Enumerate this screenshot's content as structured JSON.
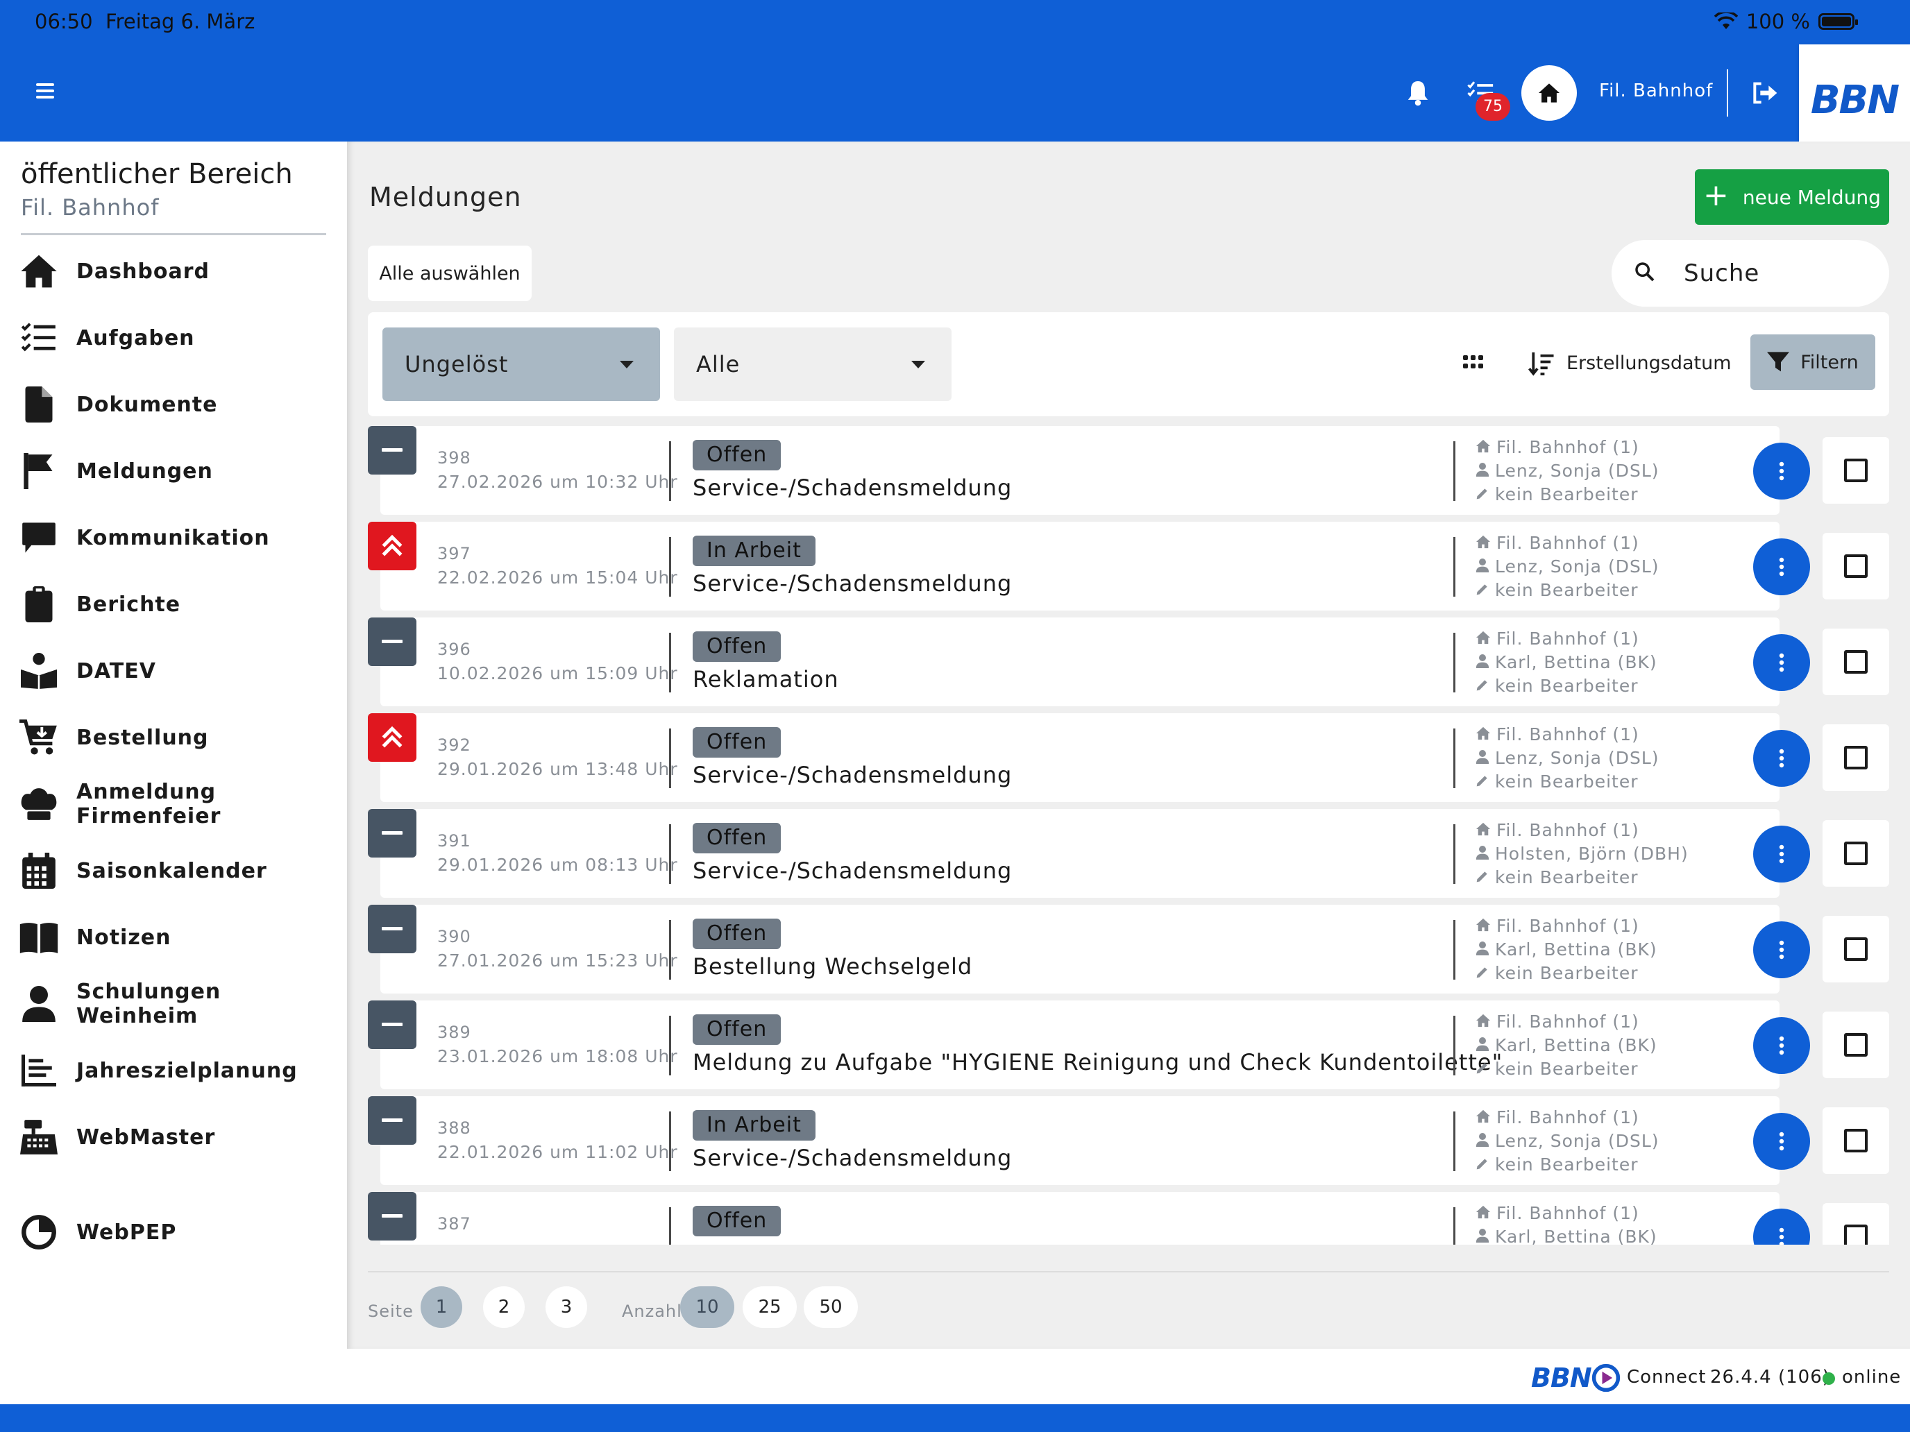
{
  "status_bar": {
    "time": "06:50",
    "date": "Freitag 6. März",
    "battery": "100 %"
  },
  "header": {
    "task_badge": "75",
    "branch": "Fil. Bahnhof",
    "logo": "BBN"
  },
  "sidebar": {
    "title": "öffentlicher Bereich",
    "subtitle": "Fil. Bahnhof",
    "items": [
      {
        "label": "Dashboard",
        "icon": "home-icon"
      },
      {
        "label": "Aufgaben",
        "icon": "checklist-icon"
      },
      {
        "label": "Dokumente",
        "icon": "document-icon"
      },
      {
        "label": "Meldungen",
        "icon": "flag-icon"
      },
      {
        "label": "Kommunikation",
        "icon": "chat-icon"
      },
      {
        "label": "Berichte",
        "icon": "clipboard-icon"
      },
      {
        "label": "DATEV",
        "icon": "reader-icon"
      },
      {
        "label": "Bestellung",
        "icon": "cart-icon"
      },
      {
        "label": "Anmeldung Firmenfeier",
        "icon": "chef-hat-icon"
      },
      {
        "label": "Saisonkalender",
        "icon": "calendar-icon"
      },
      {
        "label": "Notizen",
        "icon": "book-icon"
      },
      {
        "label": "Schulungen Weinheim",
        "icon": "person-icon"
      },
      {
        "label": "Jahreszielplanung",
        "icon": "bar-list-icon"
      },
      {
        "label": "WebMaster",
        "icon": "cash-register-icon"
      },
      {
        "label": "WebPEP",
        "icon": "pie-chart-icon"
      }
    ]
  },
  "main": {
    "title": "Meldungen",
    "new_button": "neue Meldung",
    "select_all": "Alle auswählen",
    "search_placeholder": "Suche",
    "filter_status": "Ungelöst",
    "filter_type": "Alle",
    "sort_label": "Erstellungsdatum",
    "filter_button": "Filtern"
  },
  "reports": [
    {
      "id": "398",
      "date": "27.02.2026 um 10:32 Uhr",
      "status": "Offen",
      "title": "Service-/Schadensmeldung",
      "branch": "Fil. Bahnhof (1)",
      "person": "Lenz, Sonja (DSL)",
      "editor": "kein Bearbeiter",
      "priority": "normal"
    },
    {
      "id": "397",
      "date": "22.02.2026 um 15:04 Uhr",
      "status": "In Arbeit",
      "title": "Service-/Schadensmeldung",
      "branch": "Fil. Bahnhof (1)",
      "person": "Lenz, Sonja (DSL)",
      "editor": "kein Bearbeiter",
      "priority": "high"
    },
    {
      "id": "396",
      "date": "10.02.2026 um 15:09 Uhr",
      "status": "Offen",
      "title": "Reklamation",
      "branch": "Fil. Bahnhof (1)",
      "person": "Karl, Bettina (BK)",
      "editor": "kein Bearbeiter",
      "priority": "normal"
    },
    {
      "id": "392",
      "date": "29.01.2026 um 13:48 Uhr",
      "status": "Offen",
      "title": "Service-/Schadensmeldung",
      "branch": "Fil. Bahnhof (1)",
      "person": "Lenz, Sonja (DSL)",
      "editor": "kein Bearbeiter",
      "priority": "high"
    },
    {
      "id": "391",
      "date": "29.01.2026 um 08:13 Uhr",
      "status": "Offen",
      "title": "Service-/Schadensmeldung",
      "branch": "Fil. Bahnhof (1)",
      "person": "Holsten, Björn (DBH)",
      "editor": "kein Bearbeiter",
      "priority": "normal"
    },
    {
      "id": "390",
      "date": "27.01.2026 um 15:23 Uhr",
      "status": "Offen",
      "title": "Bestellung Wechselgeld",
      "branch": "Fil. Bahnhof (1)",
      "person": "Karl, Bettina (BK)",
      "editor": "kein Bearbeiter",
      "priority": "normal"
    },
    {
      "id": "389",
      "date": "23.01.2026 um 18:08 Uhr",
      "status": "Offen",
      "title": "Meldung zu Aufgabe \"HYGIENE Reinigung und Check Kundentoilette\"",
      "branch": "Fil. Bahnhof (1)",
      "person": "Karl, Bettina (BK)",
      "editor": "kein Bearbeiter",
      "priority": "normal"
    },
    {
      "id": "388",
      "date": "22.01.2026 um 11:02 Uhr",
      "status": "In Arbeit",
      "title": "Service-/Schadensmeldung",
      "branch": "Fil. Bahnhof (1)",
      "person": "Lenz, Sonja (DSL)",
      "editor": "kein Bearbeiter",
      "priority": "normal"
    },
    {
      "id": "387",
      "date": "",
      "status": "Offen",
      "title": "",
      "branch": "Fil. Bahnhof (1)",
      "person": "Karl, Bettina (BK)",
      "editor": "",
      "priority": "normal"
    }
  ],
  "pagination": {
    "page_label": "Seite",
    "pages": [
      "1",
      "2",
      "3"
    ],
    "count_label": "Anzahl",
    "counts": [
      "10",
      "25",
      "50"
    ]
  },
  "footer": {
    "logo": "BBN",
    "connect": "Connect",
    "version": "26.4.4 (106)",
    "online": "online"
  },
  "colors": {
    "brand_blue": "#0f5fd6",
    "new_button": "#15a044",
    "priority_high": "#e0171f",
    "priority_normal": "#475564",
    "online": "#2fb14a"
  }
}
